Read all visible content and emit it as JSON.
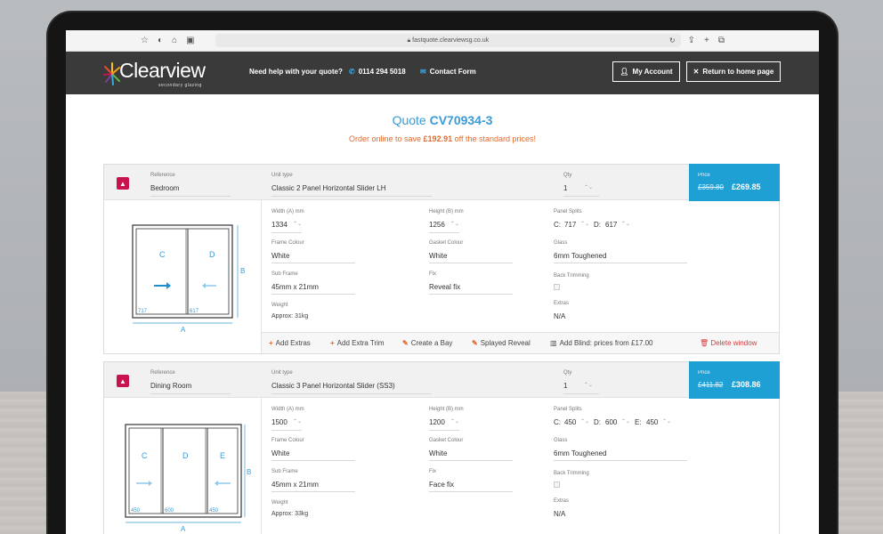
{
  "browser": {
    "url": "fastquote.clearviewsg.co.uk"
  },
  "header": {
    "logo_text": "Clearview",
    "logo_sub": "secondary glazing",
    "help_text": "Need help with your quote?",
    "phone": "0114 294 5018",
    "contact": "Contact Form",
    "account_btn": "My Account",
    "home_btn": "Return to home page"
  },
  "quote": {
    "prefix": "Quote",
    "id": "CV70934-3",
    "offer_pre": "Order online to save",
    "offer_amount": "£192.91",
    "offer_post": "off the standard prices!"
  },
  "labels": {
    "reference": "Reference",
    "unit_type": "Unit type",
    "qty": "Qty",
    "price": "Price",
    "width": "Width (A) mm",
    "height": "Height (B) mm",
    "panel_splits": "Panel Splits",
    "frame_colour": "Frame Colour",
    "gasket_colour": "Gasket Colour",
    "glass": "Glass",
    "sub_frame": "Sub Frame",
    "fix": "Fix",
    "back_trimming": "Back Trimming",
    "weight": "Weight",
    "extras": "Extras"
  },
  "actions": {
    "add_extras": "Add Extras",
    "add_extra_trim": "Add Extra Trim",
    "create_bay": "Create a Bay",
    "splayed_reveal": "Splayed Reveal",
    "add_blind": "Add Blind: prices from £17.00",
    "delete_window": "Delete window"
  },
  "windows": [
    {
      "reference": "Bedroom",
      "unit_type": "Classic 2 Panel Horizontal Slider LH",
      "qty": "1",
      "old_price": "£359.80",
      "price": "£269.85",
      "width": "1334",
      "height": "1256",
      "split_c_label": "C:",
      "split_c": "717",
      "split_d_label": "D:",
      "split_d": "617",
      "frame_colour": "White",
      "gasket_colour": "White",
      "glass": "6mm Toughened",
      "sub_frame": "45mm x 21mm",
      "fix": "Reveal fix",
      "weight": "Approx: 31kg",
      "extras": "N/A",
      "diagram": {
        "c": "C",
        "d": "D",
        "a": "A",
        "b": "B",
        "left_dim": "717",
        "right_dim": "617"
      }
    },
    {
      "reference": "Dining Room",
      "unit_type": "Classic 3 Panel Horizontal Slider (SS3)",
      "qty": "1",
      "old_price": "£411.82",
      "price": "£308.86",
      "width": "1500",
      "height": "1200",
      "split_c_label": "C:",
      "split_c": "450",
      "split_d_label": "D:",
      "split_d": "600",
      "split_e_label": "E:",
      "split_e": "450",
      "frame_colour": "White",
      "gasket_colour": "White",
      "glass": "6mm Toughened",
      "sub_frame": "45mm x 21mm",
      "fix": "Face fix",
      "weight": "Approx: 33kg",
      "extras": "N/A",
      "diagram": {
        "c": "C",
        "d": "D",
        "e": "E",
        "a": "A",
        "b": "B",
        "dim1": "450",
        "dim2": "600",
        "dim3": "450"
      }
    }
  ]
}
